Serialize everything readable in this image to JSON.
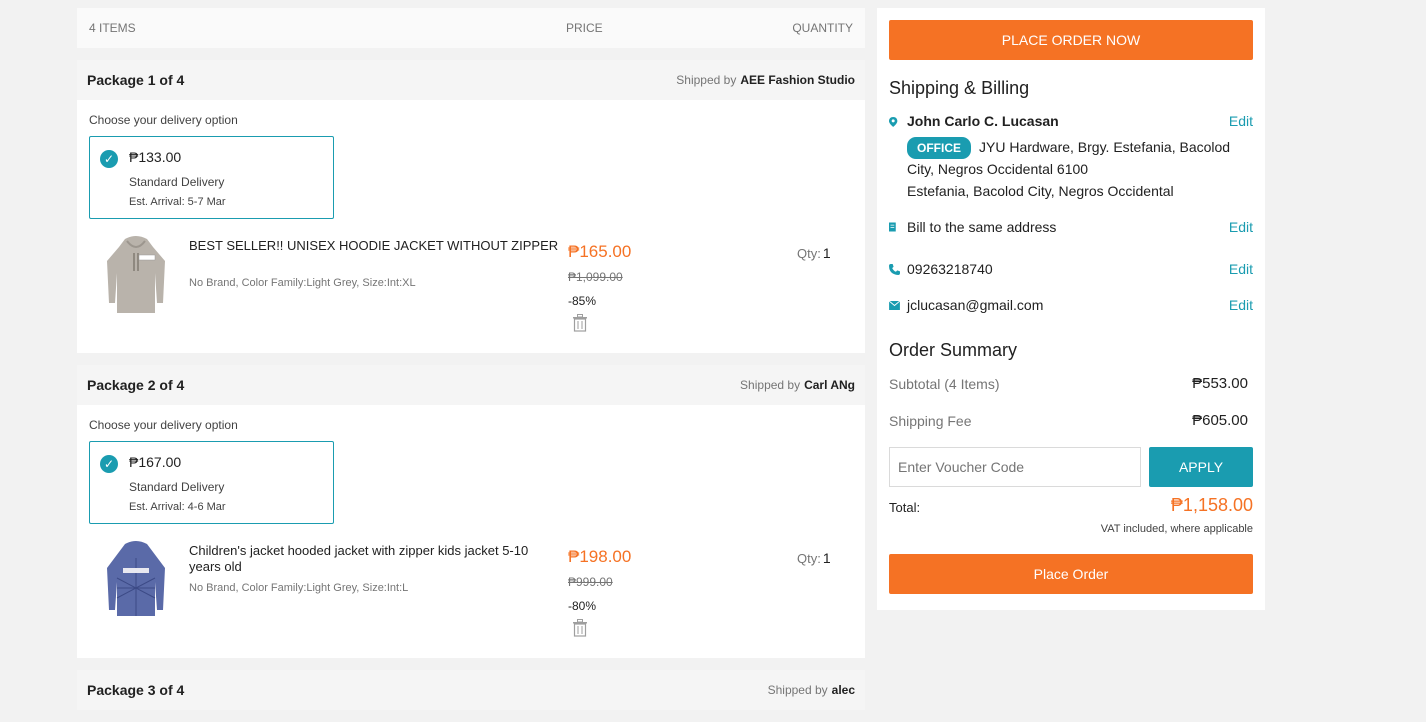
{
  "cart_header": {
    "items": "4 ITEMS",
    "price": "PRICE",
    "quantity": "QUANTITY"
  },
  "packages": [
    {
      "title": "Package 1 of 4",
      "shipped_by_label": "Shipped by",
      "seller": "AEE Fashion Studio",
      "choose_label": "Choose your delivery option",
      "delivery": {
        "price": "₱133.00",
        "type": "Standard Delivery",
        "arrival": "Est. Arrival: 5-7 Mar"
      },
      "product": {
        "title": "BEST SELLER!! UNISEX HOODIE JACKET WITHOUT ZIPPER",
        "meta": "No Brand, Color Family:Light Grey, Size:Int:XL",
        "price": "₱165.00",
        "original_price": "₱1,099.00",
        "discount": "-85%",
        "qty_label": "Qty:",
        "qty": "1"
      }
    },
    {
      "title": "Package 2 of 4",
      "shipped_by_label": "Shipped by",
      "seller": "Carl ANg",
      "choose_label": "Choose your delivery option",
      "delivery": {
        "price": "₱167.00",
        "type": "Standard Delivery",
        "arrival": "Est. Arrival: 4-6 Mar"
      },
      "product": {
        "title": "Children's jacket hooded jacket with zipper kids jacket 5-10 years old",
        "meta": "No Brand, Color Family:Light Grey, Size:Int:L",
        "price": "₱198.00",
        "original_price": "₱999.00",
        "discount": "-80%",
        "qty_label": "Qty:",
        "qty": "1"
      }
    },
    {
      "title": "Package 3 of 4",
      "shipped_by_label": "Shipped by",
      "seller": "alec"
    }
  ],
  "summary_panel": {
    "place_order_now": "PLACE ORDER NOW",
    "shipping_billing_title": "Shipping & Billing",
    "name": "John Carlo C. Lucasan",
    "address_tag": "OFFICE",
    "address_line1": "JYU Hardware, Brgy. Estefania, Bacolod City, Negros Occidental 6100",
    "address_line2": "Estefania, Bacolod City, Negros Occidental",
    "bill_same": "Bill to the same address",
    "phone": "09263218740",
    "email": "jclucasan@gmail.com",
    "edit_label": "Edit",
    "order_summary_title": "Order Summary",
    "subtotal_label": "Subtotal (4 Items)",
    "subtotal_value": "₱553.00",
    "shipping_fee_label": "Shipping Fee",
    "shipping_fee_value": "₱605.00",
    "voucher_placeholder": "Enter Voucher Code",
    "apply_label": "APPLY",
    "total_label": "Total:",
    "total_value": "₱1,158.00",
    "vat_note": "VAT included, where applicable",
    "place_order": "Place Order"
  },
  "colors": {
    "accent_orange": "#f57224",
    "accent_teal": "#1a9cb0"
  }
}
